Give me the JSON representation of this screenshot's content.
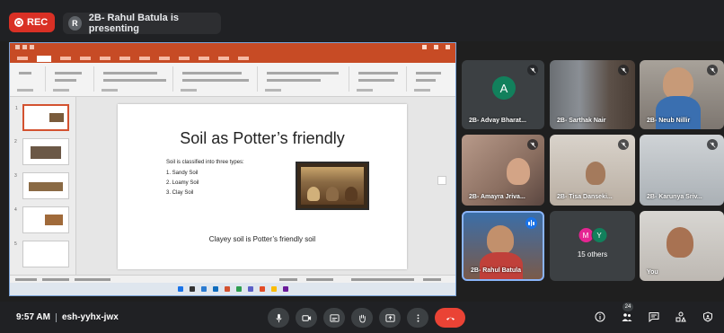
{
  "top": {
    "rec_label": "REC",
    "presenter_initial": "R",
    "presenting_text": "2B- Rahul Batula is presenting"
  },
  "slide": {
    "title": "Soil as Potter’s friendly",
    "intro": "Soil is classified into three types:",
    "list": [
      "1.   Sandy Soil",
      "2.   Loamy Soil",
      "3.   Clay Soil"
    ],
    "footer": "Clayey soil is Potter’s friendly soil"
  },
  "participants": [
    {
      "name": "2B- Advay Bharat...",
      "initial": "A"
    },
    {
      "name": "2B- Sarthak Nair"
    },
    {
      "name": "2B- Neub Nillir"
    },
    {
      "name": "2B- Amayra Jriva..."
    },
    {
      "name": "2B- Tisa Danseki..."
    },
    {
      "name": "2B- Karunya Sriv..."
    },
    {
      "name": "2B- Rahul Batula"
    },
    {
      "name": "15 others",
      "avatars": [
        "M",
        "Y"
      ]
    },
    {
      "name": "You"
    }
  ],
  "bottom": {
    "time": "9:57 AM",
    "meeting_code": "esh-yyhx-jwx",
    "people_count": "24"
  },
  "colors": {
    "rec": "#d93025",
    "end_call": "#ea4335",
    "speaking": "#1a73e8",
    "ppt": "#c74b25"
  }
}
